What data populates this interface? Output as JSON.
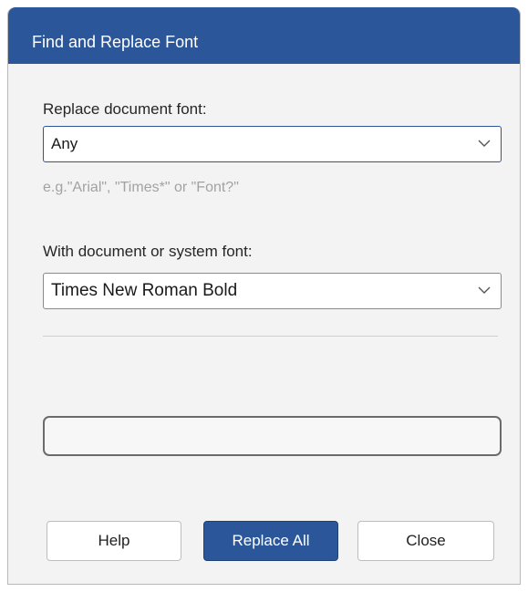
{
  "dialog": {
    "title": "Find and Replace Font"
  },
  "replace_section": {
    "label": "Replace document font:",
    "selected_value": "Any",
    "hint": "e.g.\"Arial\",  \"Times*\" or \"Font?\""
  },
  "with_section": {
    "label": "With document or system font:",
    "selected_value": "Times New Roman Bold"
  },
  "progress": {
    "fraction": 0
  },
  "buttons": {
    "help_label": "Help",
    "replace_all_label": "Replace All",
    "close_label": "Close"
  },
  "icons": {
    "dropdown": "chevron-down-icon"
  },
  "colors": {
    "accent": "#2b579a",
    "dialog_background": "#f3f3f3",
    "hint_text": "#a2a2a2"
  }
}
